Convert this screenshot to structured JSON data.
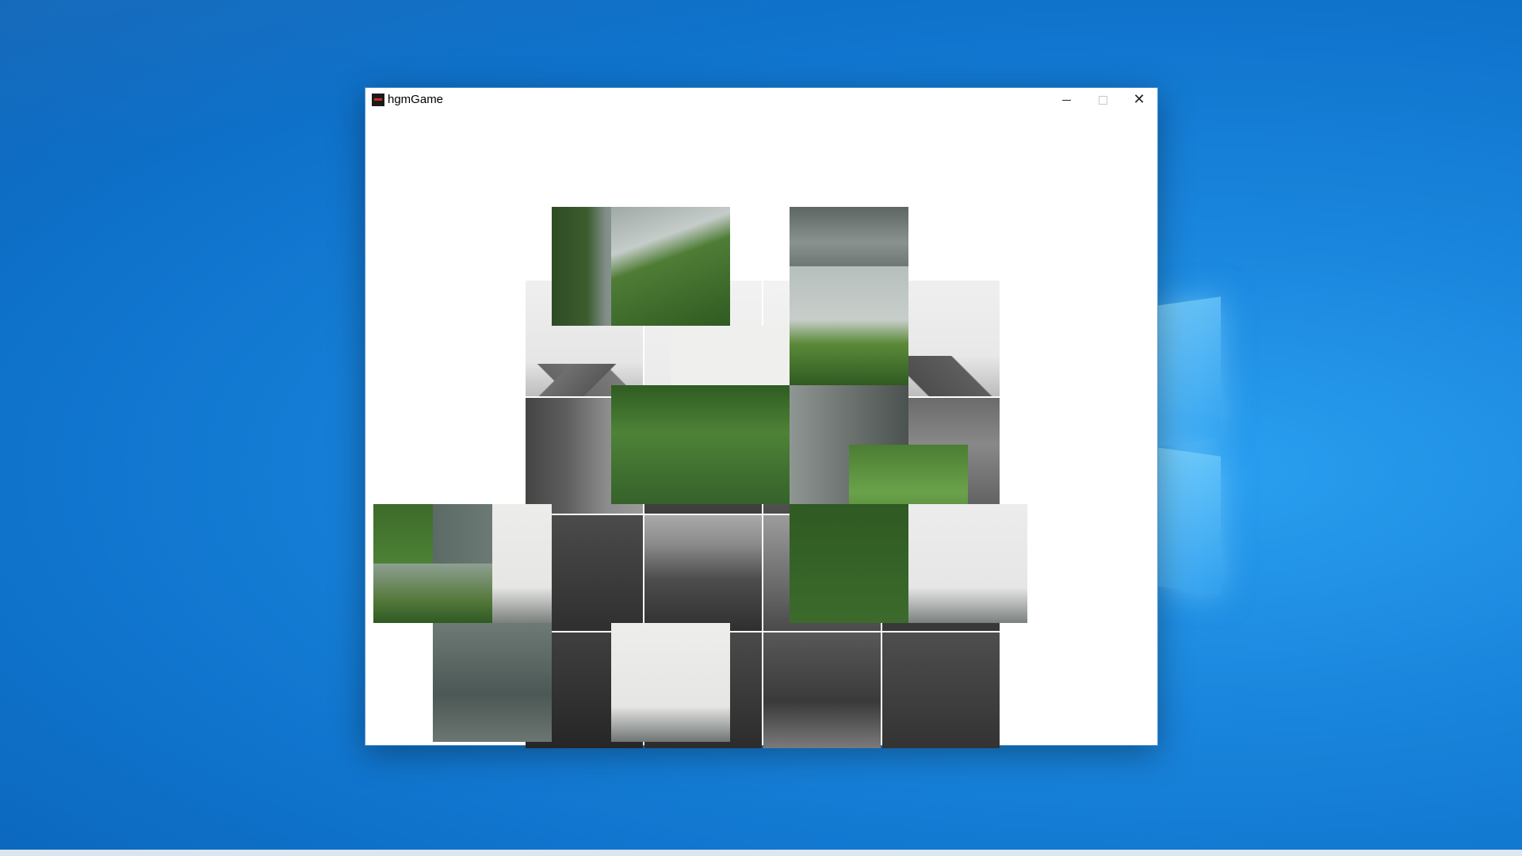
{
  "window": {
    "title": "hgmGame",
    "controls": {
      "minimize": "minimize",
      "maximize": "maximize",
      "close": "✕"
    }
  },
  "icons": [
    "app-icon",
    "minimize-icon",
    "maximize-icon",
    "close-icon"
  ],
  "colors": {
    "desktop_blue": "#0f73cc",
    "window_bg": "#ffffff",
    "foliage_green": "#3d6b2a",
    "mist_gray": "#d9dcd9",
    "mountain_gray": "#6c7270",
    "bw_dark": "#3a3a3a"
  },
  "puzzle": {
    "tile_count": 28,
    "tile_styles": [
      "green-foliage",
      "misty-mountain",
      "grayscale-forest",
      "sky-with-peak",
      "river-view",
      "palm-trees"
    ]
  }
}
